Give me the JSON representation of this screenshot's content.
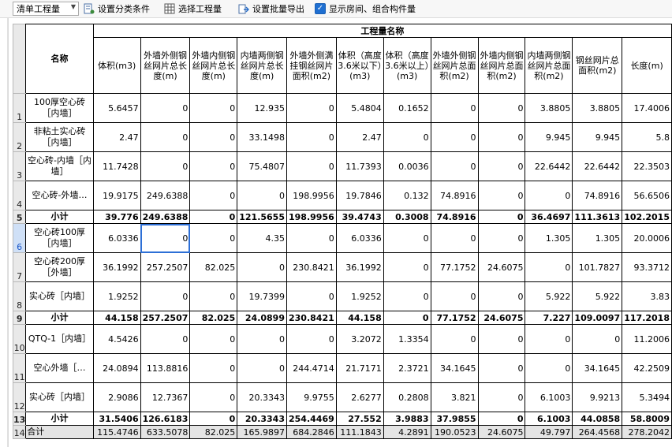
{
  "toolbar": {
    "combo_value": "清单工程量",
    "set_category_label": "设置分类条件",
    "select_qty_label": "选择工程量",
    "batch_export_label": "设置批量导出",
    "show_rooms_label": "显示房间、组合构件量",
    "show_rooms_checked": true
  },
  "table": {
    "group_header": "工程量名称",
    "name_header": "名称",
    "columns": [
      "体积(m3)",
      "外墙外侧钢丝网片总长度(m)",
      "外墙内侧钢丝网片总长度(m)",
      "内墙两侧钢丝网片总长度(m)",
      "外墙外侧满挂钢丝网片面积(m2)",
      "体积（高度3.6米以下）(m3)",
      "体积（高度3.6米以上）(m3)",
      "外墙外侧钢丝网片总面积(m2)",
      "外墙内侧钢丝网片总面积(m2)",
      "内墙两侧钢丝网片总面积(m2)",
      "钢丝网片总面积(m2)",
      "长度(m)"
    ],
    "rows": [
      {
        "num": "1",
        "name": "100厚空心砖［内墙］",
        "values": [
          "5.6457",
          "0",
          "0",
          "12.935",
          "0",
          "5.4804",
          "0.1652",
          "0",
          "0",
          "3.8805",
          "3.8805",
          "17.4006"
        ]
      },
      {
        "num": "2",
        "name": "非粘土实心砖［内墙］",
        "values": [
          "2.47",
          "0",
          "0",
          "33.1498",
          "0",
          "2.47",
          "0",
          "0",
          "0",
          "9.945",
          "9.945",
          "5.8"
        ]
      },
      {
        "num": "3",
        "name": "空心砖-内墙［内墙］",
        "values": [
          "11.7428",
          "0",
          "0",
          "75.4807",
          "0",
          "11.7393",
          "0.0036",
          "0",
          "0",
          "22.6442",
          "22.6442",
          "22.3503"
        ]
      },
      {
        "num": "4",
        "name": "空心砖-外墙…",
        "values": [
          "19.9175",
          "249.6388",
          "0",
          "0",
          "198.9956",
          "19.7846",
          "0.132",
          "74.8916",
          "0",
          "0",
          "74.8916",
          "56.6506"
        ]
      },
      {
        "num": "5",
        "name": "小计",
        "subtotal": true,
        "values": [
          "39.776",
          "249.6388",
          "0",
          "121.5655",
          "198.9956",
          "39.4743",
          "0.3008",
          "74.8916",
          "0",
          "36.4697",
          "111.3613",
          "102.2015"
        ]
      },
      {
        "num": "6",
        "name": "空心砖100厚［内墙］",
        "selected": true,
        "values": [
          "6.0336",
          "0",
          "0",
          "4.35",
          "0",
          "6.0336",
          "0",
          "0",
          "0",
          "1.305",
          "1.305",
          "20.0006"
        ]
      },
      {
        "num": "7",
        "name": "空心砖200厚［外墙］",
        "values": [
          "36.1992",
          "257.2507",
          "82.025",
          "0",
          "230.8421",
          "36.1992",
          "0",
          "77.1752",
          "24.6075",
          "0",
          "101.7827",
          "93.3712"
        ]
      },
      {
        "num": "8",
        "name": "实心砖［内墙］",
        "values": [
          "1.9252",
          "0",
          "0",
          "19.7399",
          "0",
          "1.9252",
          "0",
          "0",
          "0",
          "5.922",
          "5.922",
          "3.83"
        ]
      },
      {
        "num": "9",
        "name": "小计",
        "subtotal": true,
        "values": [
          "44.158",
          "257.2507",
          "82.025",
          "24.0899",
          "230.8421",
          "44.158",
          "0",
          "77.1752",
          "24.6075",
          "7.227",
          "109.0097",
          "117.2018"
        ]
      },
      {
        "num": "10",
        "name": "QTQ-1［内墙］",
        "values": [
          "4.5426",
          "0",
          "0",
          "0",
          "0",
          "3.2072",
          "1.3354",
          "0",
          "0",
          "0",
          "0",
          "11.2006"
        ]
      },
      {
        "num": "11",
        "name": "空心外墙［…",
        "values": [
          "24.0894",
          "113.8816",
          "0",
          "0",
          "244.4714",
          "21.7171",
          "2.3721",
          "34.1645",
          "0",
          "0",
          "34.1645",
          "42.2509"
        ]
      },
      {
        "num": "12",
        "name": "实心砖［内墙］",
        "values": [
          "2.9086",
          "12.7367",
          "0",
          "20.3343",
          "9.9755",
          "2.6277",
          "0.2808",
          "3.821",
          "0",
          "6.1003",
          "9.9213",
          "5.3494"
        ]
      },
      {
        "num": "13",
        "name": "小计",
        "subtotal": true,
        "values": [
          "31.5406",
          "126.6183",
          "0",
          "20.3343",
          "254.4469",
          "27.552",
          "3.9883",
          "37.9855",
          "0",
          "6.1003",
          "44.0858",
          "58.8009"
        ]
      },
      {
        "num": "14",
        "name": "合计",
        "total": true,
        "values": [
          "115.4746",
          "633.5078",
          "82.025",
          "165.9897",
          "684.2846",
          "111.1843",
          "4.2891",
          "190.0523",
          "24.6075",
          "49.797",
          "264.4568",
          "278.2042"
        ]
      }
    ]
  },
  "colors": {
    "accent": "#1f6fd1",
    "selection": "#2d6fd6",
    "total_row": "#e4e4e4",
    "header_bg": "#e9e9e9"
  }
}
